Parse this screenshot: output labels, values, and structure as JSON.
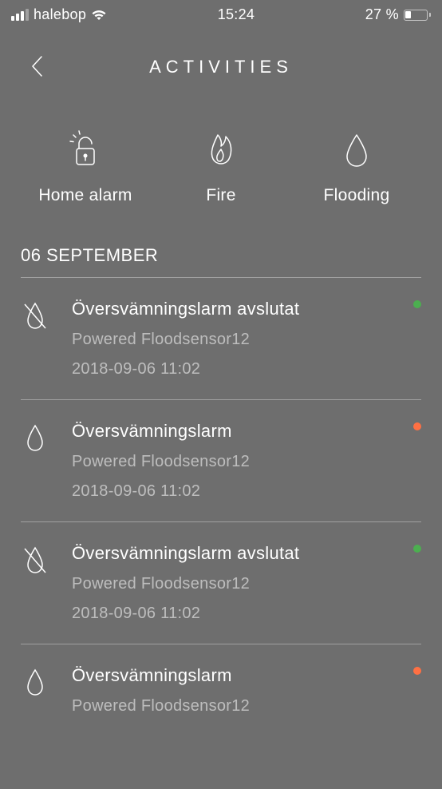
{
  "status_bar": {
    "carrier": "halebop",
    "time": "15:24",
    "battery_pct": "27 %"
  },
  "header": {
    "title": "ACTIVITIES"
  },
  "categories": [
    {
      "id": "home-alarm",
      "label": "Home alarm",
      "icon": "padlock-icon"
    },
    {
      "id": "fire",
      "label": "Fire",
      "icon": "fire-icon"
    },
    {
      "id": "flooding",
      "label": "Flooding",
      "icon": "drop-icon"
    }
  ],
  "date_header": "06 SEPTEMBER",
  "activities": [
    {
      "icon": "drop-crossed-icon",
      "title": "Översvämningslarm avslutat",
      "subtitle": "Powered Floodsensor12",
      "timestamp": "2018-09-06 11:02",
      "status": "green"
    },
    {
      "icon": "drop-icon",
      "title": "Översvämningslarm",
      "subtitle": "Powered Floodsensor12",
      "timestamp": "2018-09-06 11:02",
      "status": "orange"
    },
    {
      "icon": "drop-crossed-icon",
      "title": "Översvämningslarm avslutat",
      "subtitle": "Powered Floodsensor12",
      "timestamp": "2018-09-06 11:02",
      "status": "green"
    },
    {
      "icon": "drop-icon",
      "title": "Översvämningslarm",
      "subtitle": "Powered Floodsensor12",
      "timestamp": "",
      "status": "orange"
    }
  ],
  "colors": {
    "green": "#4caf50",
    "orange": "#ff7043"
  }
}
